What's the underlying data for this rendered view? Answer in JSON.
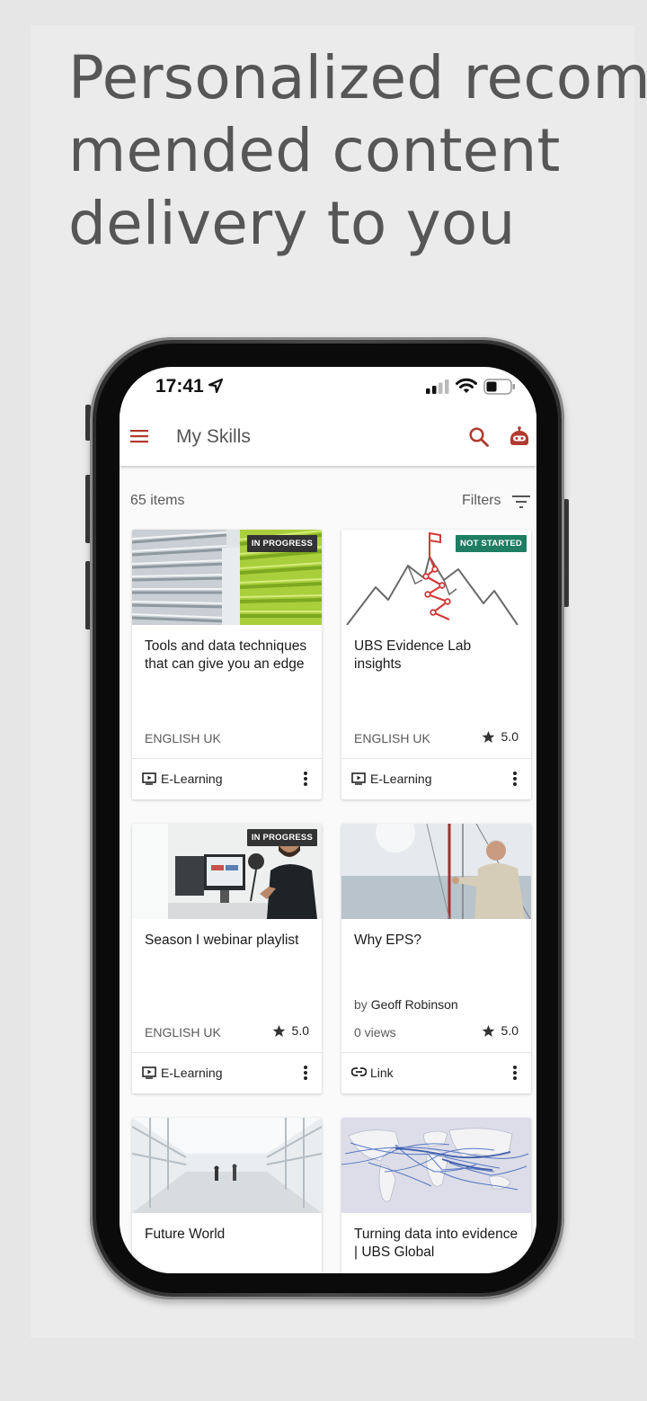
{
  "headline": [
    "Personalized recom-",
    "mended content",
    "delivery to you"
  ],
  "status_bar": {
    "time": "17:41"
  },
  "app_bar": {
    "title": "My Skills"
  },
  "list": {
    "count": "65 items",
    "filters_label": "Filters"
  },
  "colors": {
    "brand_red": "#b03a2e",
    "badge_in_progress": "#333333",
    "badge_not_started": "#1e7d62"
  },
  "cards": [
    {
      "title": "Tools and data techniques that can give you an edge",
      "badge": "IN PROGRESS",
      "language": "ENGLISH UK",
      "rating": "",
      "type": "E-Learning",
      "type_icon": "play-screen-icon"
    },
    {
      "title": "UBS Evidence Lab insights",
      "badge": "NOT STARTED",
      "language": "ENGLISH UK",
      "rating": "5.0",
      "type": "E-Learning",
      "type_icon": "play-screen-icon"
    },
    {
      "title": "Season I webinar playlist",
      "badge": "IN PROGRESS",
      "language": "ENGLISH UK",
      "rating": "5.0",
      "type": "E-Learning",
      "type_icon": "play-screen-icon"
    },
    {
      "title": "Why EPS?",
      "badge": "",
      "by_label": "by",
      "author": "Geoff Robinson",
      "views": "0 views",
      "rating": "5.0",
      "type": "Link",
      "type_icon": "link-icon"
    },
    {
      "title": "Future World",
      "badge": ""
    },
    {
      "title": "Turning data into evidence | UBS Global",
      "badge": ""
    }
  ]
}
